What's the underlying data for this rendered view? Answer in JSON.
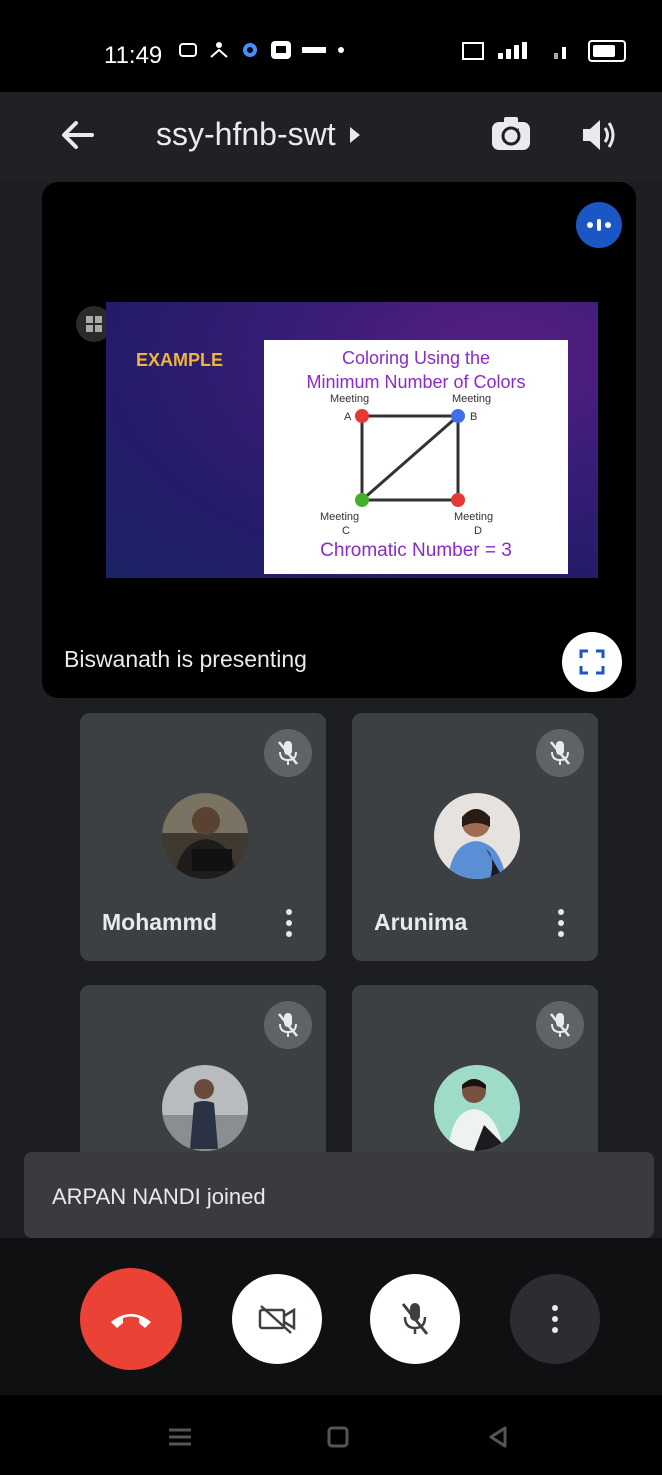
{
  "status_bar": {
    "time": "11:49",
    "icons": [
      "screen-record-icon",
      "accessibility-icon",
      "settings-icon",
      "cast-icon",
      "notification-icon",
      "dot-icon"
    ],
    "right_icons": [
      "volte-icon",
      "signal-icon",
      "wifi-signal-icon",
      "battery-icon"
    ]
  },
  "top_bar": {
    "meeting_code": "ssy-hfnb-swt",
    "icons": [
      "back-arrow-icon",
      "chevron-right-icon",
      "switch-camera-icon",
      "speaker-icon"
    ]
  },
  "presentation": {
    "presenting_text": "Biswanath is presenting",
    "slide": {
      "example_label": "EXAMPLE",
      "title_line1": "Coloring Using the",
      "title_line2": "Minimum Number of Colors",
      "nodes": [
        {
          "label": "Meeting",
          "letter": "A",
          "color": "#e53935"
        },
        {
          "label": "Meeting",
          "letter": "B",
          "color": "#3f6ee8"
        },
        {
          "label": "Meeting",
          "letter": "C",
          "color": "#43b02a"
        },
        {
          "label": "Meeting",
          "letter": "D",
          "color": "#e53935"
        }
      ],
      "footer": "Chromatic Number = 3"
    }
  },
  "participants": [
    {
      "name": "Mohammd",
      "mic": "muted"
    },
    {
      "name": "Arunima",
      "mic": "muted"
    },
    {
      "name": "",
      "mic": "muted"
    },
    {
      "name": "",
      "mic": "muted"
    }
  ],
  "toast": {
    "text": "ARPAN NANDI joined"
  },
  "controls": {
    "buttons": [
      "end-call",
      "camera-off",
      "mic-off",
      "more-options"
    ],
    "colors": {
      "end_call": "#ea4335",
      "accent": "#1a56c4"
    }
  },
  "nav_bar": {
    "icons": [
      "menu-icon",
      "home-icon",
      "back-icon"
    ]
  }
}
